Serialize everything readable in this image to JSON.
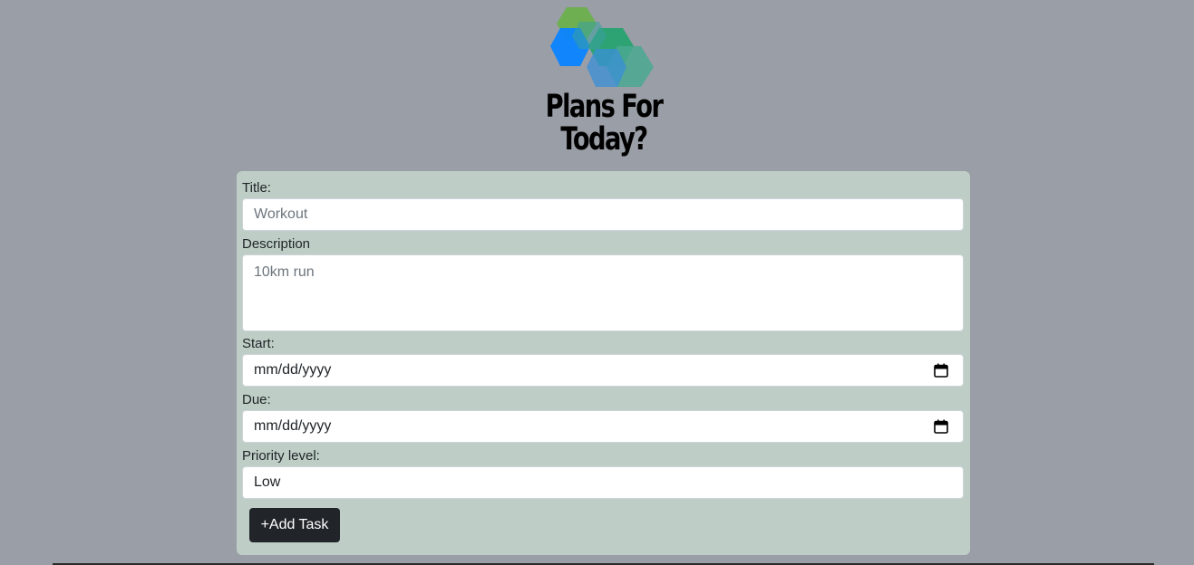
{
  "app": {
    "title_line1": "Plans For",
    "title_line2": "Today?"
  },
  "logo": {
    "icon": "hexagon-cubes-logo-icon",
    "colors": [
      "#6ab04c",
      "#0a84ff",
      "#1aa36a",
      "#3a8fd8"
    ]
  },
  "form": {
    "title_label": "Title:",
    "title_placeholder": "Workout",
    "description_label": "Description",
    "description_placeholder": "10km run",
    "start_label": "Start:",
    "start_value": "mm/dd/yyyy",
    "due_label": "Due:",
    "due_value": "mm/dd/yyyy",
    "priority_label": "Priority level:",
    "priority_value": "Low",
    "add_button_label": "+Add Task"
  },
  "colors": {
    "page_background": "#9a9ea6",
    "card_background": "#becec6",
    "button_background": "#212529"
  }
}
